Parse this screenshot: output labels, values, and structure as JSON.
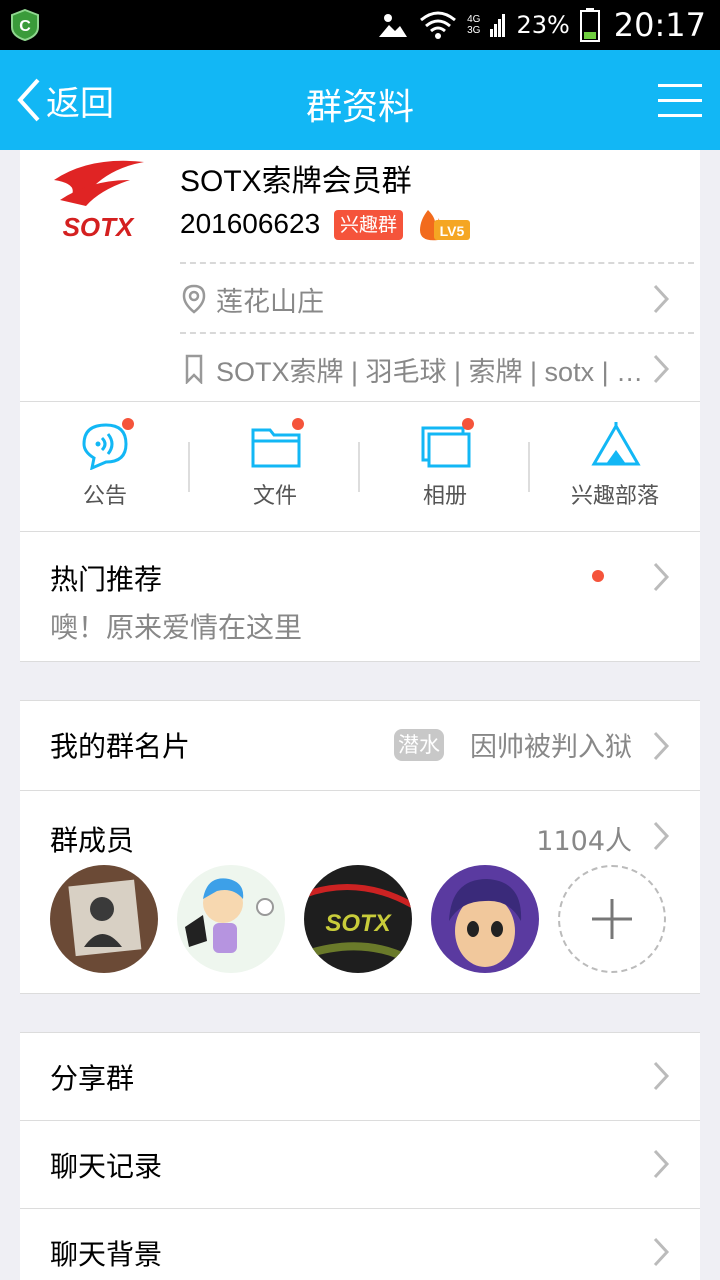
{
  "status_bar": {
    "network": [
      "4G",
      "3G"
    ],
    "battery": "23%",
    "time": "20:17",
    "icons": [
      "app-icon",
      "weather-icon",
      "wifi-icon",
      "signal-icon",
      "battery-icon"
    ]
  },
  "nav": {
    "back_label": "返回",
    "title": "群资料"
  },
  "group": {
    "name": "SOTX索牌会员群",
    "id": "201606623",
    "tag": "兴趣群",
    "level": "LV5",
    "location": "莲花山庄",
    "keywords": "SOTX索牌 | 羽毛球 | 索牌 | sotx | …"
  },
  "actions": [
    {
      "label": "公告"
    },
    {
      "label": "文件"
    },
    {
      "label": "相册"
    },
    {
      "label": "兴趣部落"
    }
  ],
  "hot": {
    "title": "热门推荐",
    "subtitle": "噢！原来爱情在这里"
  },
  "card": {
    "label": "我的群名片",
    "badge": "潜水",
    "value": "因帅被判入狱"
  },
  "members": {
    "label": "群成员",
    "count": "1104人"
  },
  "menu": [
    {
      "label": "分享群"
    },
    {
      "label": "聊天记录"
    },
    {
      "label": "聊天背景"
    }
  ],
  "colors": {
    "primary": "#12b7f5",
    "accent_red": "#f5543b",
    "background": "#efeff4"
  }
}
